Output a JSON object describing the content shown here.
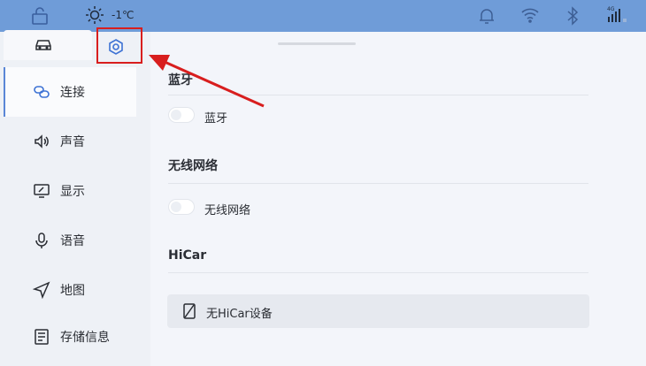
{
  "status_bar": {
    "temperature": "-1℃",
    "signal_label": "4G"
  },
  "sidebar": {
    "items": [
      {
        "label": "连接",
        "icon": "link-icon",
        "active": true
      },
      {
        "label": "声音",
        "icon": "speaker-icon"
      },
      {
        "label": "显示",
        "icon": "display-icon"
      },
      {
        "label": "语音",
        "icon": "microphone-icon"
      },
      {
        "label": "地图",
        "icon": "navigation-icon"
      },
      {
        "label": "存储信息",
        "icon": "storage-icon"
      }
    ]
  },
  "sections": {
    "bluetooth": {
      "title": "蓝牙",
      "toggle_label": "蓝牙",
      "on": false
    },
    "wifi": {
      "title": "无线网络",
      "toggle_label": "无线网络",
      "on": false
    },
    "hicar": {
      "title": "HiCar",
      "device_label": "无HiCar设备"
    }
  },
  "colors": {
    "status_bar": "#6f9cd8",
    "highlight": "#d81e1e"
  }
}
